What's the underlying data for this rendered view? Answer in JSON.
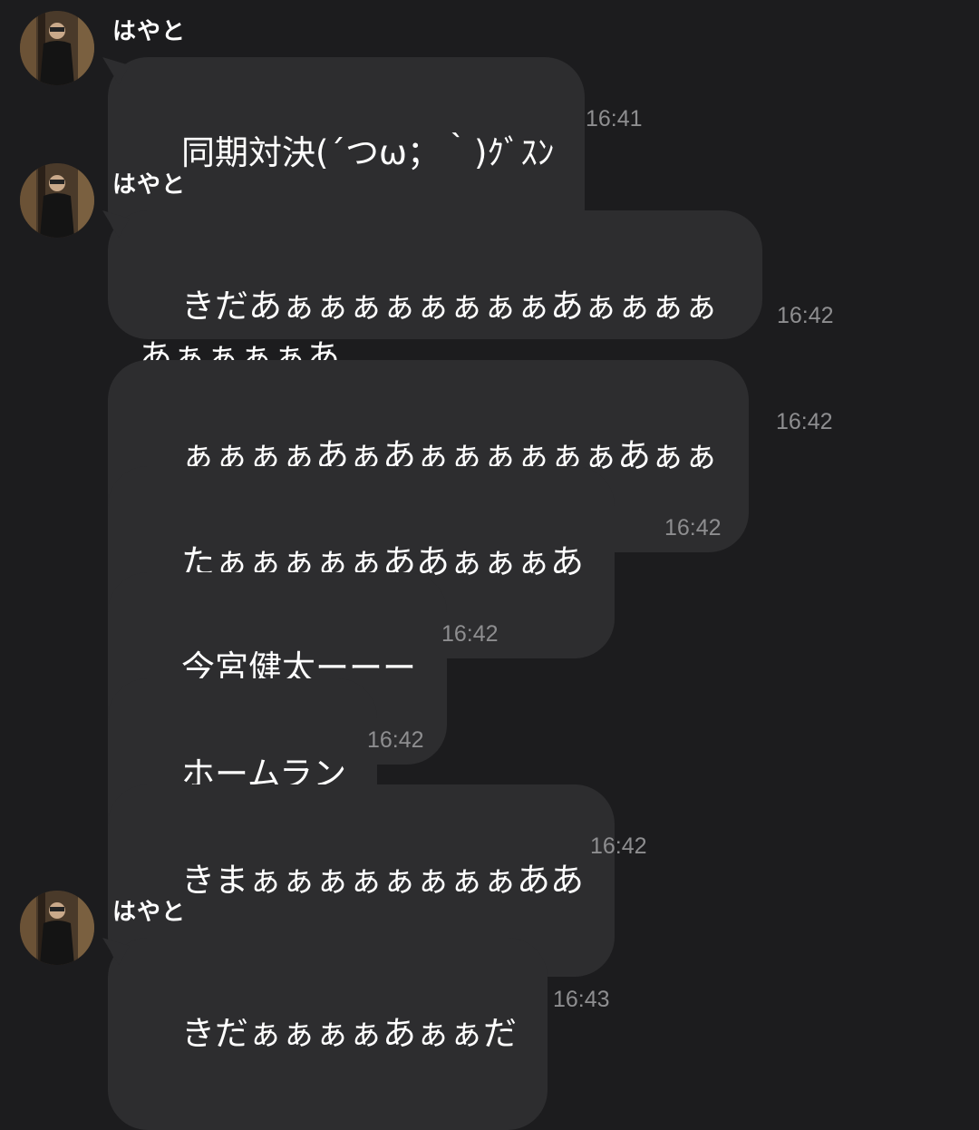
{
  "messages": [
    {
      "sender": "はやと",
      "text": "同期対決(´つω；｀)ｸﾞｽﾝ",
      "time": "16:41"
    },
    {
      "sender": "はやと",
      "text": "きだあぁぁぁぁぁぁぁぁあぁぁぁぁあぁぁぁぁあ",
      "time": "16:42"
    },
    {
      "text": "ぁぁぁぁあぁあぁぁぁぁぁぁあぁぁ",
      "time": "16:42"
    },
    {
      "text": "たぁぁぁぁぁああぁぁぁあ",
      "time": "16:42"
    },
    {
      "text": "今宮健太ーーー",
      "time": "16:42"
    },
    {
      "text": "ホームラン",
      "time": "16:42"
    },
    {
      "text": "きまぁぁぁぁぁぁぁぁああ",
      "time": "16:42"
    },
    {
      "sender": "はやと",
      "text": "きだぁぁぁぁあぁぁだ",
      "time": "16:43"
    }
  ],
  "colors": {
    "background": "#1c1c1e",
    "bubble": "#2d2d2f",
    "text": "#ffffff",
    "timestamp": "#8e8e90"
  },
  "icons": [
    "avatar-photo"
  ]
}
